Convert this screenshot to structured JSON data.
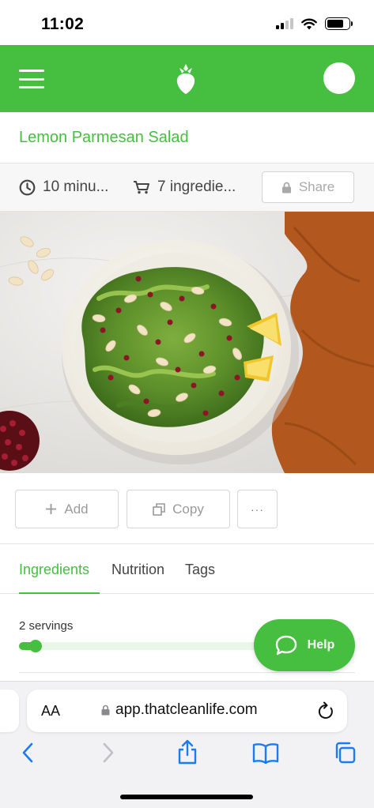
{
  "status_bar": {
    "time": "11:02"
  },
  "header": {
    "menu_icon": "hamburger-icon",
    "logo_icon": "strawberry-logo-icon"
  },
  "recipe": {
    "title": "Lemon Parmesan Salad",
    "time": "10 minu...",
    "ingredients_count": "7 ingredie...",
    "share_label": "Share"
  },
  "actions": {
    "add_label": "Add",
    "copy_label": "Copy",
    "more_label": "···"
  },
  "tabs": [
    {
      "label": "Ingredients",
      "active": true
    },
    {
      "label": "Nutrition",
      "active": false
    },
    {
      "label": "Tags",
      "active": false
    }
  ],
  "servings": {
    "label": "2 servings",
    "level": 0.07
  },
  "help": {
    "label": "Help"
  },
  "browser": {
    "aa_label": "AA",
    "url": "app.thatcleanlife.com"
  },
  "colors": {
    "brand": "#46be3f",
    "muted": "#a9a9a9",
    "ios_blue": "#1a7cf5"
  }
}
